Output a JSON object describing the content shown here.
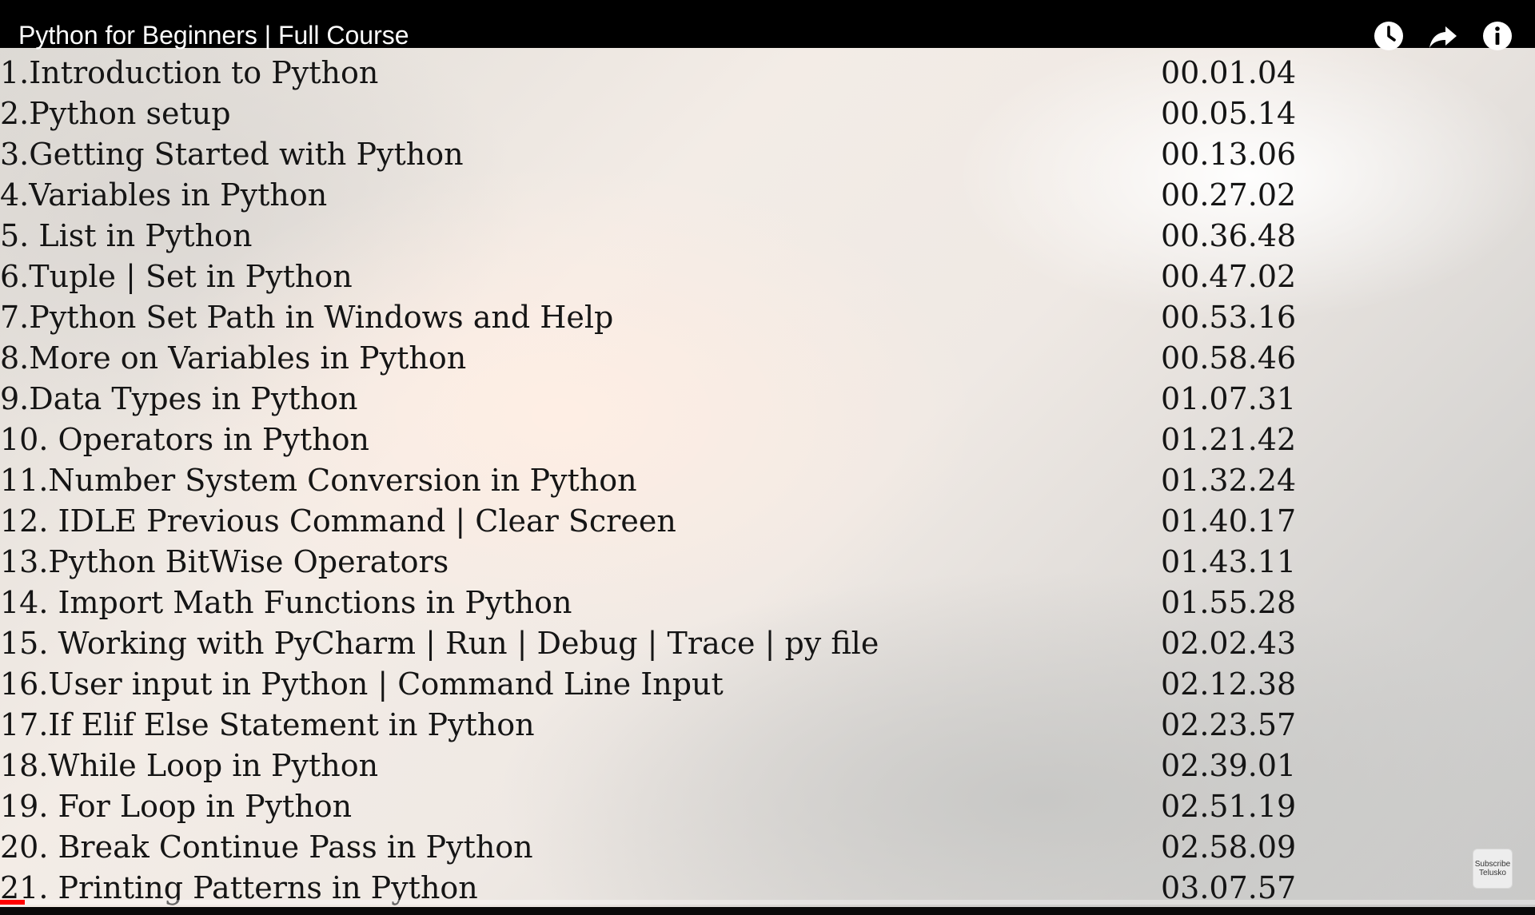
{
  "player": {
    "title": "Python for Beginners | Full Course",
    "progress_fraction": 0.016,
    "icons": {
      "watch_later": "clock-icon",
      "share": "share-arrow-icon",
      "info": "info-icon"
    }
  },
  "chapters": [
    {
      "title": "1.Introduction to Python",
      "time": "00.01.04"
    },
    {
      "title": "2.Python setup",
      "time": "00.05.14"
    },
    {
      "title": "3.Getting Started with Python",
      "time": "00.13.06"
    },
    {
      "title": "4.Variables in Python",
      "time": "00.27.02"
    },
    {
      "title": "5. List in Python",
      "time": "00.36.48"
    },
    {
      "title": "6.Tuple | Set in Python",
      "time": "00.47.02"
    },
    {
      "title": "7.Python Set Path in Windows and Help",
      "time": "00.53.16"
    },
    {
      "title": "8.More on Variables in Python",
      "time": "00.58.46"
    },
    {
      "title": "9.Data Types in Python",
      "time": "01.07.31"
    },
    {
      "title": "10. Operators in Python",
      "time": "01.21.42"
    },
    {
      "title": "11.Number System Conversion in Python",
      "time": "01.32.24"
    },
    {
      "title": "12. IDLE Previous Command | Clear Screen",
      "time": "01.40.17"
    },
    {
      "title": "13.Python BitWise Operators",
      "time": "01.43.11"
    },
    {
      "title": "14. Import Math Functions in Python",
      "time": "01.55.28"
    },
    {
      "title": "15. Working with PyCharm | Run | Debug | Trace | py file",
      "time": "02.02.43"
    },
    {
      "title": "16.User input in Python | Command Line Input",
      "time": "02.12.38"
    },
    {
      "title": "17.If Elif Else Statement in Python",
      "time": "02.23.57"
    },
    {
      "title": "18.While Loop in Python",
      "time": "02.39.01"
    },
    {
      "title": "19. For Loop in Python",
      "time": "02.51.19"
    },
    {
      "title": "20. Break Continue Pass in Python",
      "time": "02.58.09"
    },
    {
      "title": "21. Printing Patterns in Python",
      "time": "03.07.57"
    }
  ],
  "subscribe_badge": {
    "line1": "Subscribe",
    "line2": "Telusko"
  }
}
